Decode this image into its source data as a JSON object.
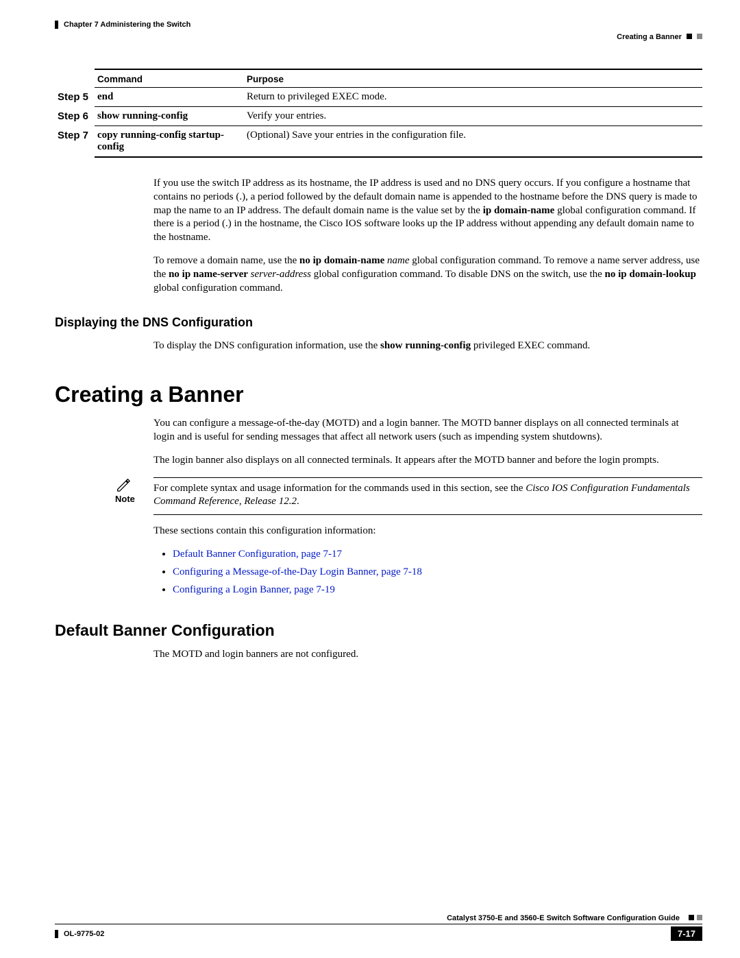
{
  "header": {
    "chapter": "Chapter 7    Administering the Switch",
    "section_right": "Creating a Banner"
  },
  "table": {
    "head_command": "Command",
    "head_purpose": "Purpose",
    "rows": [
      {
        "step": "Step 5",
        "command": "end",
        "purpose": "Return to privileged EXEC mode."
      },
      {
        "step": "Step 6",
        "command": "show running-config",
        "purpose": "Verify your entries."
      },
      {
        "step": "Step 7",
        "command": "copy running-config startup-config",
        "purpose": "(Optional) Save your entries in the configuration file."
      }
    ]
  },
  "para1_pre": "If you use the switch IP address as its hostname, the IP address is used and no DNS query occurs. If you configure a hostname that contains no periods (.), a period followed by the default domain name is appended to the hostname before the DNS query is made to map the name to an IP address. The default domain name is the value set by the ",
  "para1_bold": "ip domain-name",
  "para1_post": " global configuration command. If there is a period (.) in the hostname, the Cisco IOS software looks up the IP address without appending any default domain name to the hostname.",
  "para2": {
    "t1": "To remove a domain name, use the ",
    "b1": "no ip domain-name",
    "i1": " name",
    "t2": " global configuration command. To remove a name server address, use the ",
    "b2": "no ip name-server",
    "i2": " server-address",
    "t3": " global configuration command. To disable DNS on the switch, use the ",
    "b3": "no ip domain-lookup",
    "t4": " global configuration command."
  },
  "h3_dns": "Displaying the DNS Configuration",
  "para_dns_pre": "To display the DNS configuration information, use the ",
  "para_dns_bold": "show running-config",
  "para_dns_post": " privileged EXEC command.",
  "h1_banner": "Creating a Banner",
  "para_banner1": "You can configure a message-of-the-day (MOTD) and a login banner. The MOTD banner displays on all connected terminals at login and is useful for sending messages that affect all network users (such as impending system shutdowns).",
  "para_banner2": "The login banner also displays on all connected terminals. It appears after the MOTD banner and before the login prompts.",
  "note_label": "Note",
  "note_text_pre": "For complete syntax and usage information for the commands used in this section, see the ",
  "note_text_ital": "Cisco IOS Configuration Fundamentals Command Reference, Release 12.2",
  "note_text_post": ".",
  "para_sections": "These sections contain this configuration information:",
  "links": [
    "Default Banner Configuration, page 7-17",
    "Configuring a Message-of-the-Day Login Banner, page 7-18",
    "Configuring a Login Banner, page 7-19"
  ],
  "h2_default": "Default Banner Configuration",
  "para_default": "The MOTD and login banners are not configured.",
  "footer": {
    "guide": "Catalyst 3750-E and 3560-E Switch Software Configuration Guide",
    "doc_id": "OL-9775-02",
    "page": "7-17"
  }
}
